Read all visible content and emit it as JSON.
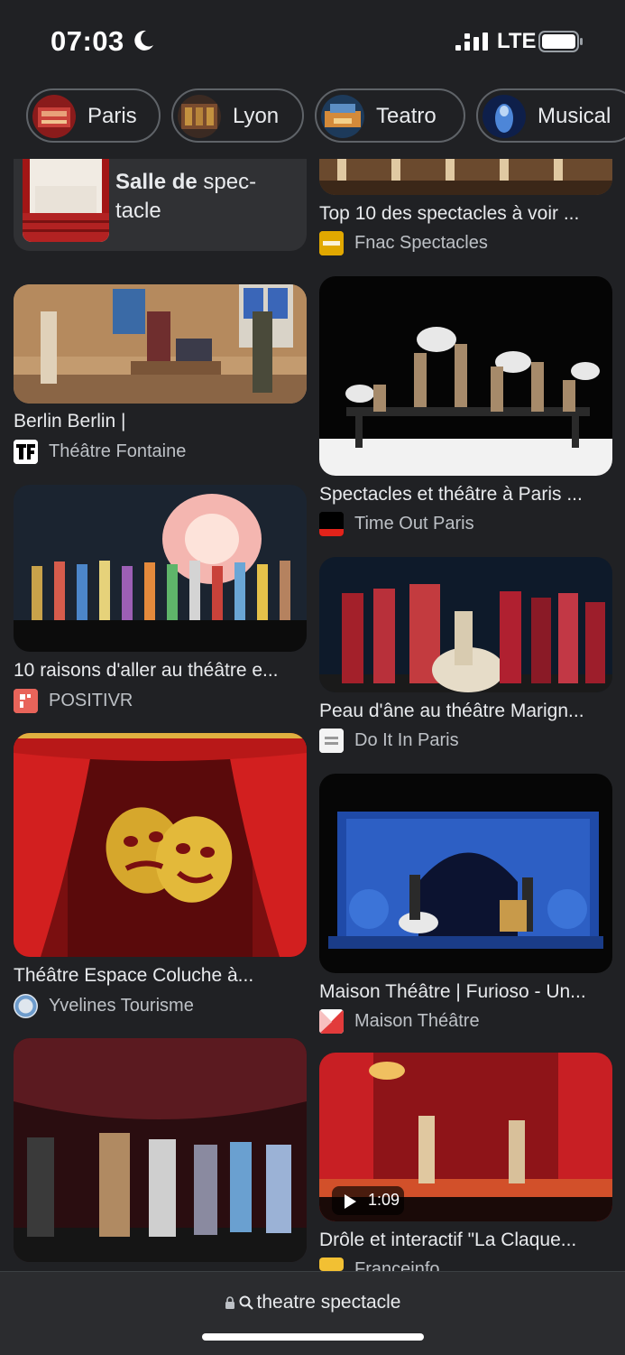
{
  "status_bar": {
    "time": "07:03",
    "network": "LTE"
  },
  "chips": [
    {
      "label": "Paris"
    },
    {
      "label": "Lyon"
    },
    {
      "label": "Teatro"
    },
    {
      "label": "Musical"
    }
  ],
  "results": {
    "salle": {
      "bold": "Salle de",
      "rest": " spec-tacle"
    },
    "r_top10": {
      "title": "Top 10 des spectacles à voir ...",
      "source": "Fnac Spectacles"
    },
    "r_berlin": {
      "title": "Berlin Berlin |",
      "source": "Théâtre Fontaine"
    },
    "r_timeout": {
      "title": "Spectacles et théâtre à Paris ...",
      "source": "Time Out Paris"
    },
    "r_raisons": {
      "title": "10 raisons d'aller au théâtre e...",
      "source": "POSITIVR"
    },
    "r_peau": {
      "title": "Peau d'âne au théâtre Marign...",
      "source": "Do It In Paris"
    },
    "r_coluche": {
      "title": "Théâtre Espace Coluche à...",
      "source": "Yvelines Tourisme"
    },
    "r_maison": {
      "title": "Maison Théâtre | Furioso - Un...",
      "source": "Maison Théâtre"
    },
    "r_drole": {
      "title": "Drôle et interactif \"La Claque...",
      "source": "Franceinfo",
      "duration": "1:09"
    }
  },
  "address_bar": {
    "text": "theatre spectacle"
  },
  "colors": {
    "background": "#202124",
    "text": "#e8eaed",
    "muted": "#bdc1c6",
    "chip_border": "#5f6368"
  },
  "icons": [
    "moon-icon",
    "signal-icon",
    "battery-icon",
    "lock-icon",
    "search-icon",
    "play-icon"
  ]
}
